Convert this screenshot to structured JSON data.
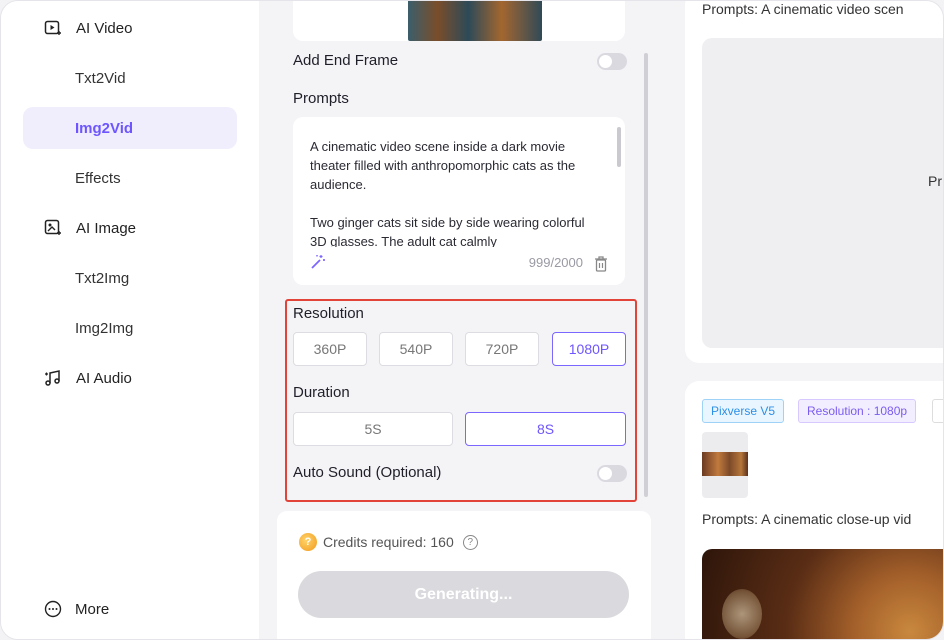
{
  "sidebar": {
    "items": [
      {
        "label": "AI Video",
        "icon": "video-sparkle-icon",
        "type": "parent"
      },
      {
        "label": "Txt2Vid",
        "type": "child"
      },
      {
        "label": "Img2Vid",
        "type": "child",
        "active": true
      },
      {
        "label": "Effects",
        "type": "child"
      },
      {
        "label": "AI Image",
        "icon": "image-sparkle-icon",
        "type": "parent"
      },
      {
        "label": "Txt2Img",
        "type": "child"
      },
      {
        "label": "Img2Img",
        "type": "child"
      },
      {
        "label": "AI Audio",
        "icon": "music-note-icon",
        "type": "parent"
      }
    ],
    "more_label": "More"
  },
  "form": {
    "end_frame_label": "Add End Frame",
    "end_frame_enabled": false,
    "prompts_label": "Prompts",
    "prompt_text": "A cinematic video scene inside a dark movie theater filled with anthropomorphic cats as the audience.\n\nTwo ginger cats sit side by side wearing colorful 3D glasses. The adult cat calmly",
    "prompt_counter": "999/2000",
    "resolution_label": "Resolution",
    "resolutions": [
      "360P",
      "540P",
      "720P",
      "1080P"
    ],
    "resolution_selected": "1080P",
    "duration_label": "Duration",
    "durations": [
      "5S",
      "8S"
    ],
    "duration_selected": "8S",
    "auto_sound_label": "Auto Sound (Optional)",
    "auto_sound_enabled": false,
    "credits_text": "Credits required: 160",
    "generate_label": "Generating..."
  },
  "results": {
    "card1_prompt": "Prompts: A cinematic video scen",
    "card1_placeholder": "Pr",
    "tags": [
      "Pixverse V5",
      "Resolution : 1080p"
    ],
    "card2_prompt": "Prompts: A cinematic close-up vid"
  },
  "colors": {
    "accent": "#6d56ff",
    "active_bg": "#f0eefc",
    "highlight_border": "#e2443a"
  }
}
